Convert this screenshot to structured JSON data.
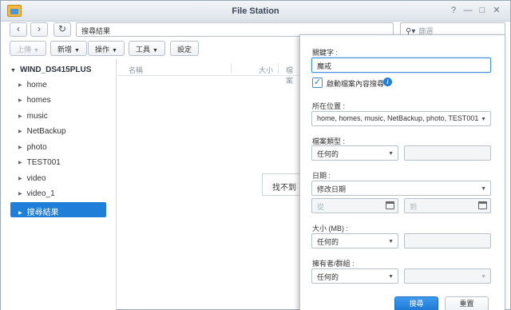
{
  "window": {
    "title": "File Station"
  },
  "titlebar_buttons": [
    "?",
    "—",
    "□",
    "✕"
  ],
  "nav": {
    "back": "‹",
    "forward": "›",
    "refresh": "↻"
  },
  "path": {
    "value": "搜尋結果"
  },
  "search": {
    "placeholder": "篩選",
    "icon": "search-icon"
  },
  "toolbar": {
    "upload": "上傳",
    "create": "新增",
    "action": "操作",
    "tools": "工具",
    "settings": "設定"
  },
  "sidebar": {
    "root": "WIND_DS415PLUS",
    "items": [
      {
        "label": "home"
      },
      {
        "label": "homes"
      },
      {
        "label": "music"
      },
      {
        "label": "NetBackup"
      },
      {
        "label": "photo"
      },
      {
        "label": "TEST001"
      },
      {
        "label": "video"
      },
      {
        "label": "video_1"
      },
      {
        "label": "搜尋結果"
      }
    ],
    "selected_index": 8
  },
  "list": {
    "columns": [
      "名稱",
      "大小",
      "檔案"
    ],
    "empty_message": "找不到"
  },
  "panel": {
    "keyword_label": "關鍵字 :",
    "keyword_value": "魔戒",
    "fulltext_label": "啟動檔案內容搜尋",
    "fulltext_checked": true,
    "location_label": "所在位置 :",
    "location_value": "home, homes, music, NetBackup, photo, TEST001",
    "filetype_label": "檔案類型 :",
    "filetype_value": "任何的",
    "date_label": "日期 :",
    "date_value": "修改日期",
    "date_from_placeholder": "從",
    "date_to_placeholder": "到",
    "size_label": "大小 (MB) :",
    "size_value": "任何的",
    "owner_label": "擁有者/群組 :",
    "owner_value": "任何的",
    "search_button": "搜尋",
    "reset_button": "重置"
  },
  "colors": {
    "accent": "#1e7ed8",
    "selected_bg": "#1e7ed8"
  }
}
